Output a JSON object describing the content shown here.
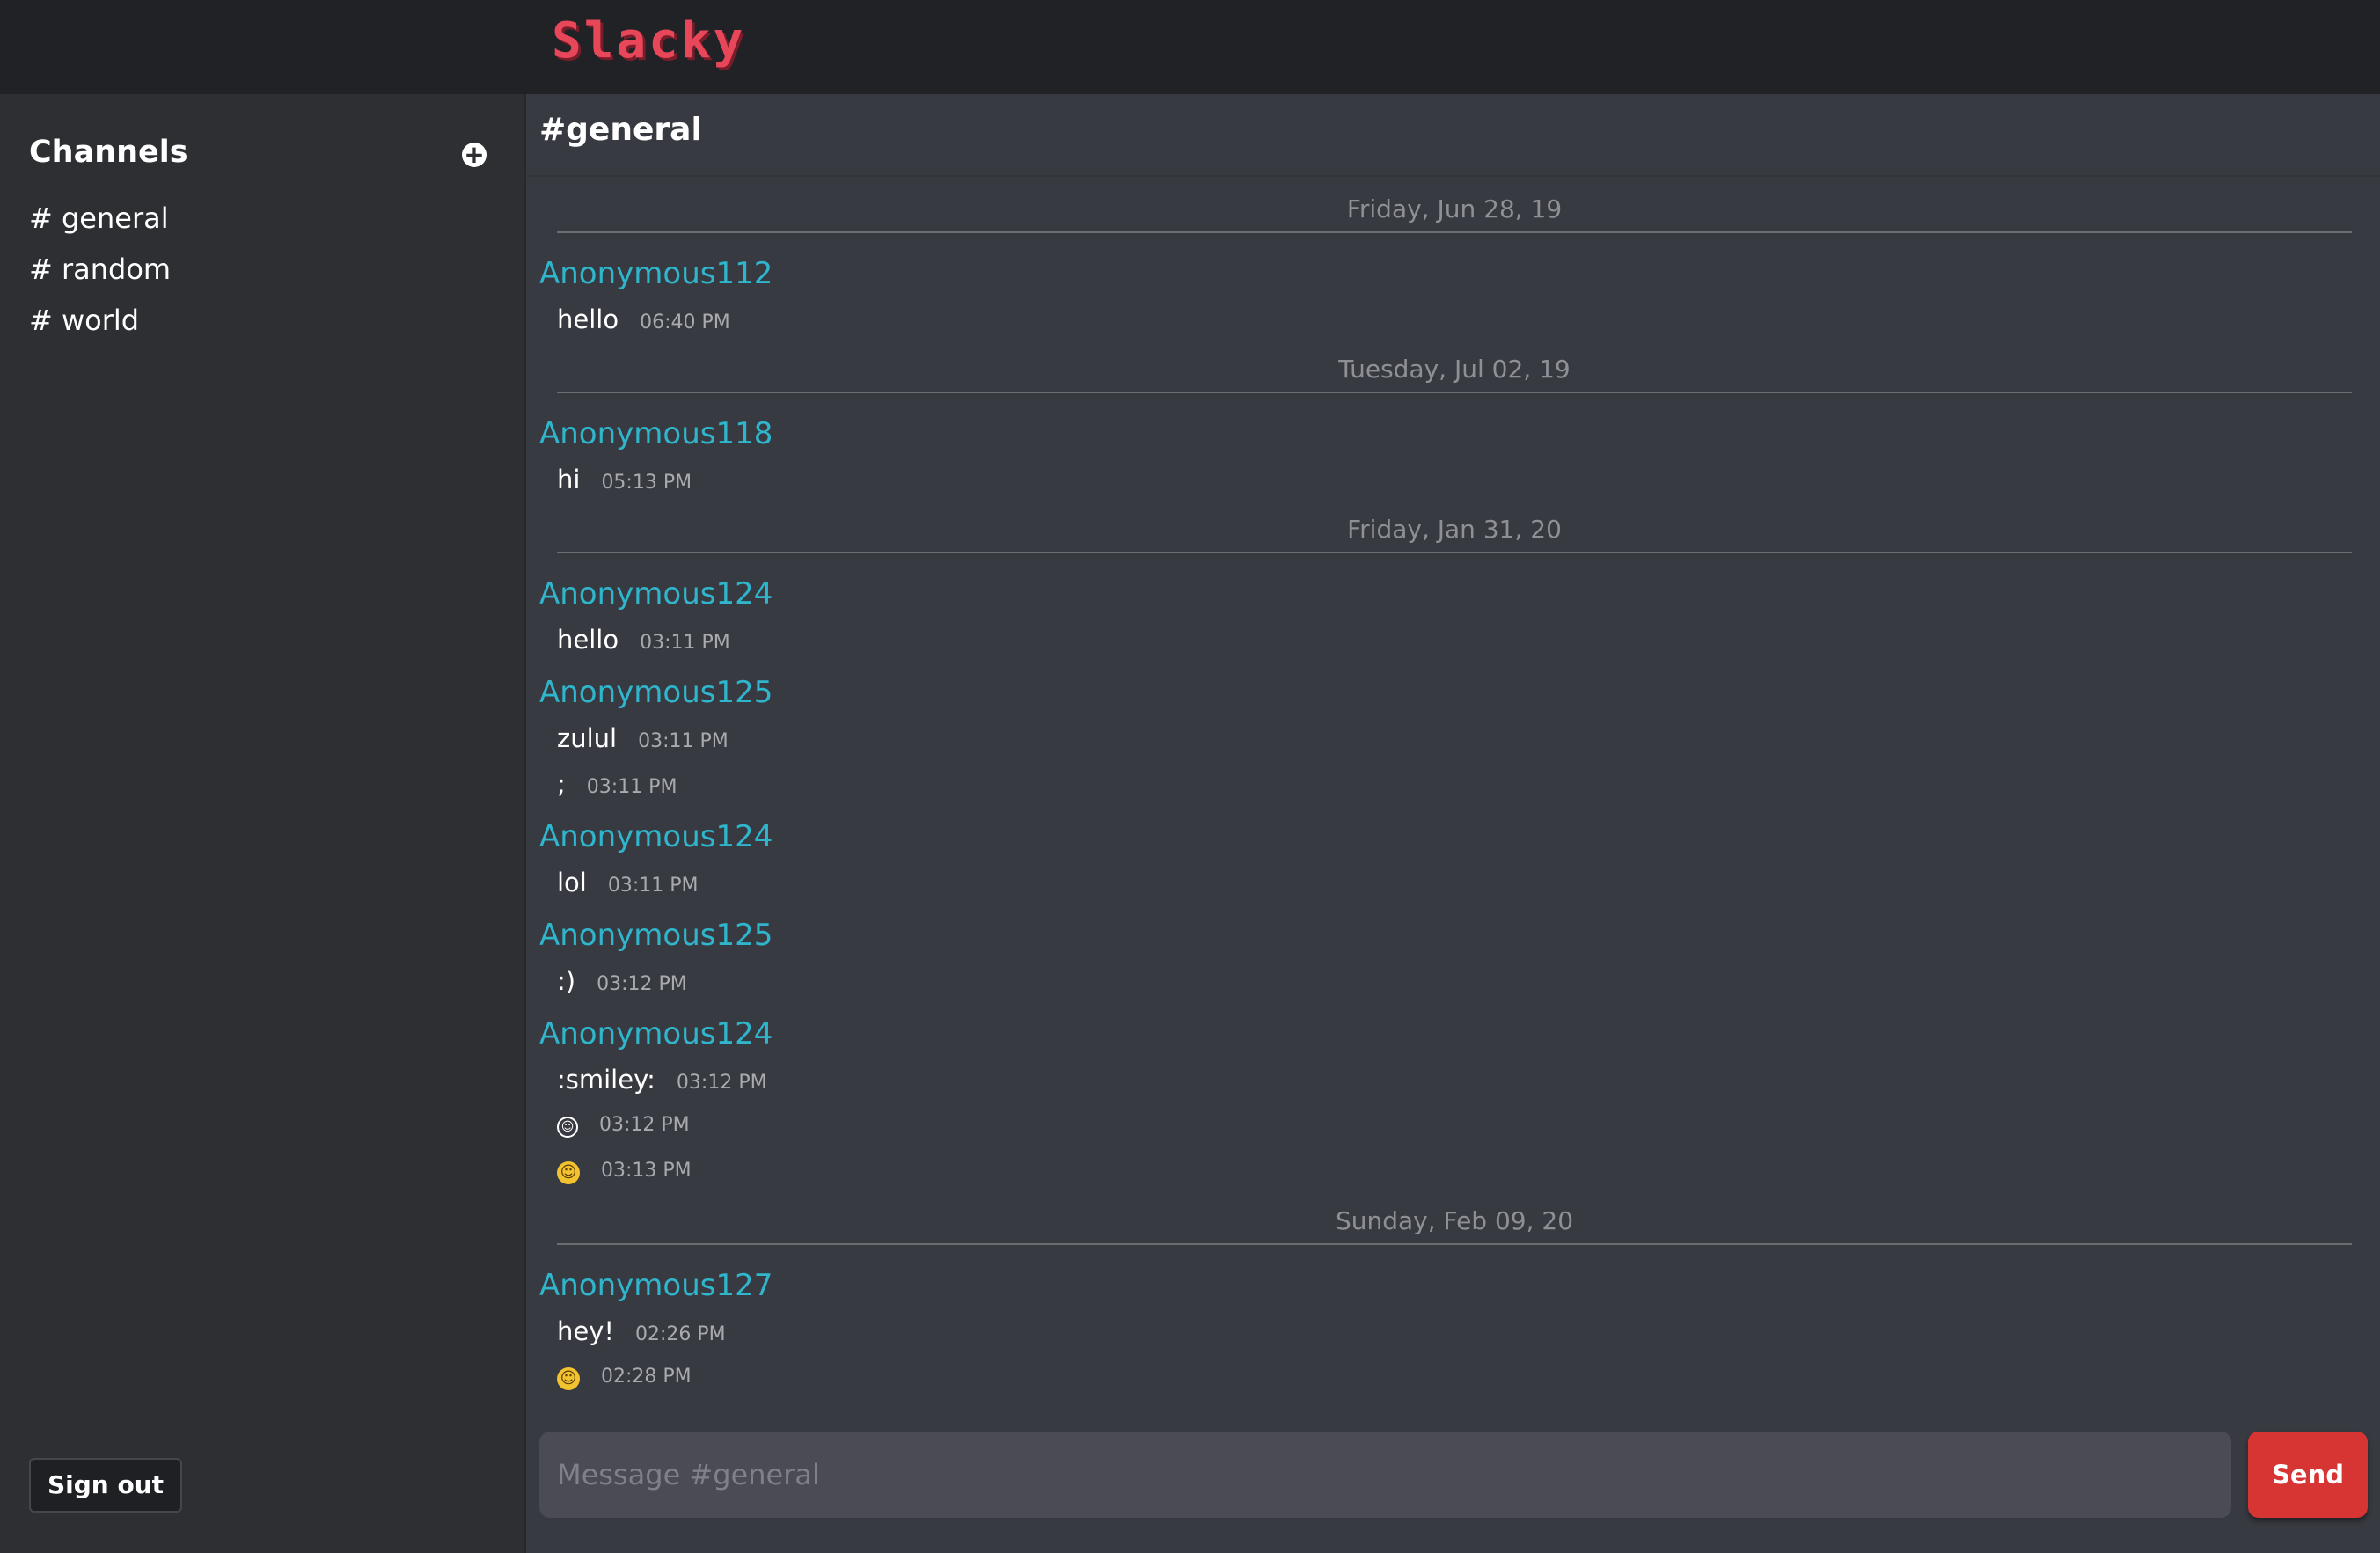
{
  "app": {
    "title": "Slacky",
    "brand_color": "#e8475a"
  },
  "sidebar": {
    "title": "Channels",
    "add_icon": "plus-circle-icon",
    "channels": [
      {
        "label": "# general"
      },
      {
        "label": "# random"
      },
      {
        "label": "# world"
      }
    ],
    "signout_label": "Sign out"
  },
  "channel": {
    "header": "#general",
    "input_placeholder": "Message #general",
    "send_label": "Send",
    "send_color": "#d63533"
  },
  "feed": {
    "dates": [
      "Friday, Jun 28, 19",
      "Tuesday, Jul 02, 19",
      "Friday, Jan 31, 20",
      "Sunday, Feb 09, 20"
    ],
    "groups": [
      {
        "user": "Anonymous112",
        "messages": [
          {
            "text": "hello",
            "time": "06:40 PM"
          }
        ]
      },
      {
        "user": "Anonymous118",
        "messages": [
          {
            "text": "hi",
            "time": "05:13 PM"
          }
        ]
      },
      {
        "user": "Anonymous124",
        "messages": [
          {
            "text": "hello",
            "time": "03:11 PM"
          }
        ]
      },
      {
        "user": "Anonymous125",
        "messages": [
          {
            "text": "zulul",
            "time": "03:11 PM"
          },
          {
            "text": ";",
            "time": "03:11 PM"
          }
        ]
      },
      {
        "user": "Anonymous124",
        "messages": [
          {
            "text": "lol",
            "time": "03:11 PM"
          }
        ]
      },
      {
        "user": "Anonymous125",
        "messages": [
          {
            "text": ":)",
            "time": "03:12 PM"
          }
        ]
      },
      {
        "user": "Anonymous124",
        "messages": [
          {
            "text": ":smiley:",
            "time": "03:12 PM"
          },
          {
            "emoji": "smiley-outline-emoji",
            "time": "03:12 PM"
          },
          {
            "emoji": "smiley-color-emoji",
            "time": "03:13 PM"
          }
        ]
      },
      {
        "user": "Anonymous127",
        "messages": [
          {
            "text": "hey!",
            "time": "02:26 PM"
          },
          {
            "emoji": "smiley-color-emoji",
            "time": "02:28 PM"
          }
        ]
      }
    ]
  }
}
